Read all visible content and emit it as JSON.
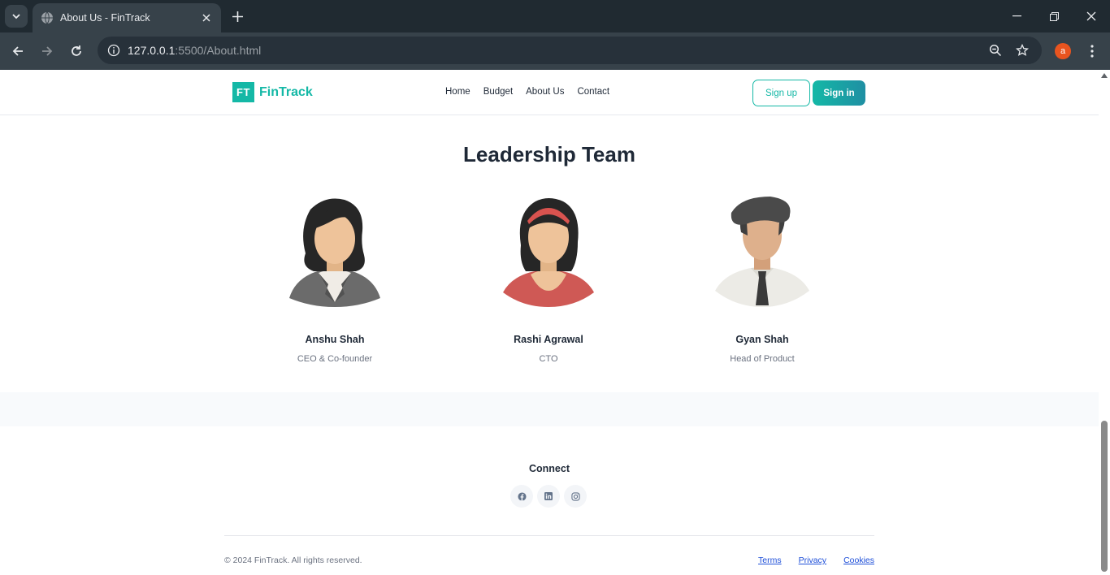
{
  "browser": {
    "tab_title": "About Us - FinTrack",
    "url_host": "127.0.0.1",
    "url_rest": ":5500/About.html",
    "profile_initial": "a"
  },
  "header": {
    "logo_mark": "FT",
    "logo_name": "FinTrack",
    "nav": [
      "Home",
      "Budget",
      "About Us",
      "Contact"
    ],
    "signup_label": "Sign up",
    "signin_label": "Sign in"
  },
  "leadership": {
    "title": "Leadership Team",
    "members": [
      {
        "name": "Anshu Shah",
        "role": "CEO & Co-founder"
      },
      {
        "name": "Rashi Agrawal",
        "role": "CTO"
      },
      {
        "name": "Gyan Shah",
        "role": "Head of Product"
      }
    ]
  },
  "footer": {
    "connect_label": "Connect",
    "socials": [
      "facebook-icon",
      "linkedin-icon",
      "instagram-icon"
    ],
    "copyright": "© 2024 FinTrack. All rights reserved.",
    "links": [
      "Terms",
      "Privacy",
      "Cookies"
    ]
  },
  "colors": {
    "brand": "#14b8a6",
    "heading": "#1f2937",
    "muted": "#6b7280",
    "link": "#1d4ed8"
  }
}
